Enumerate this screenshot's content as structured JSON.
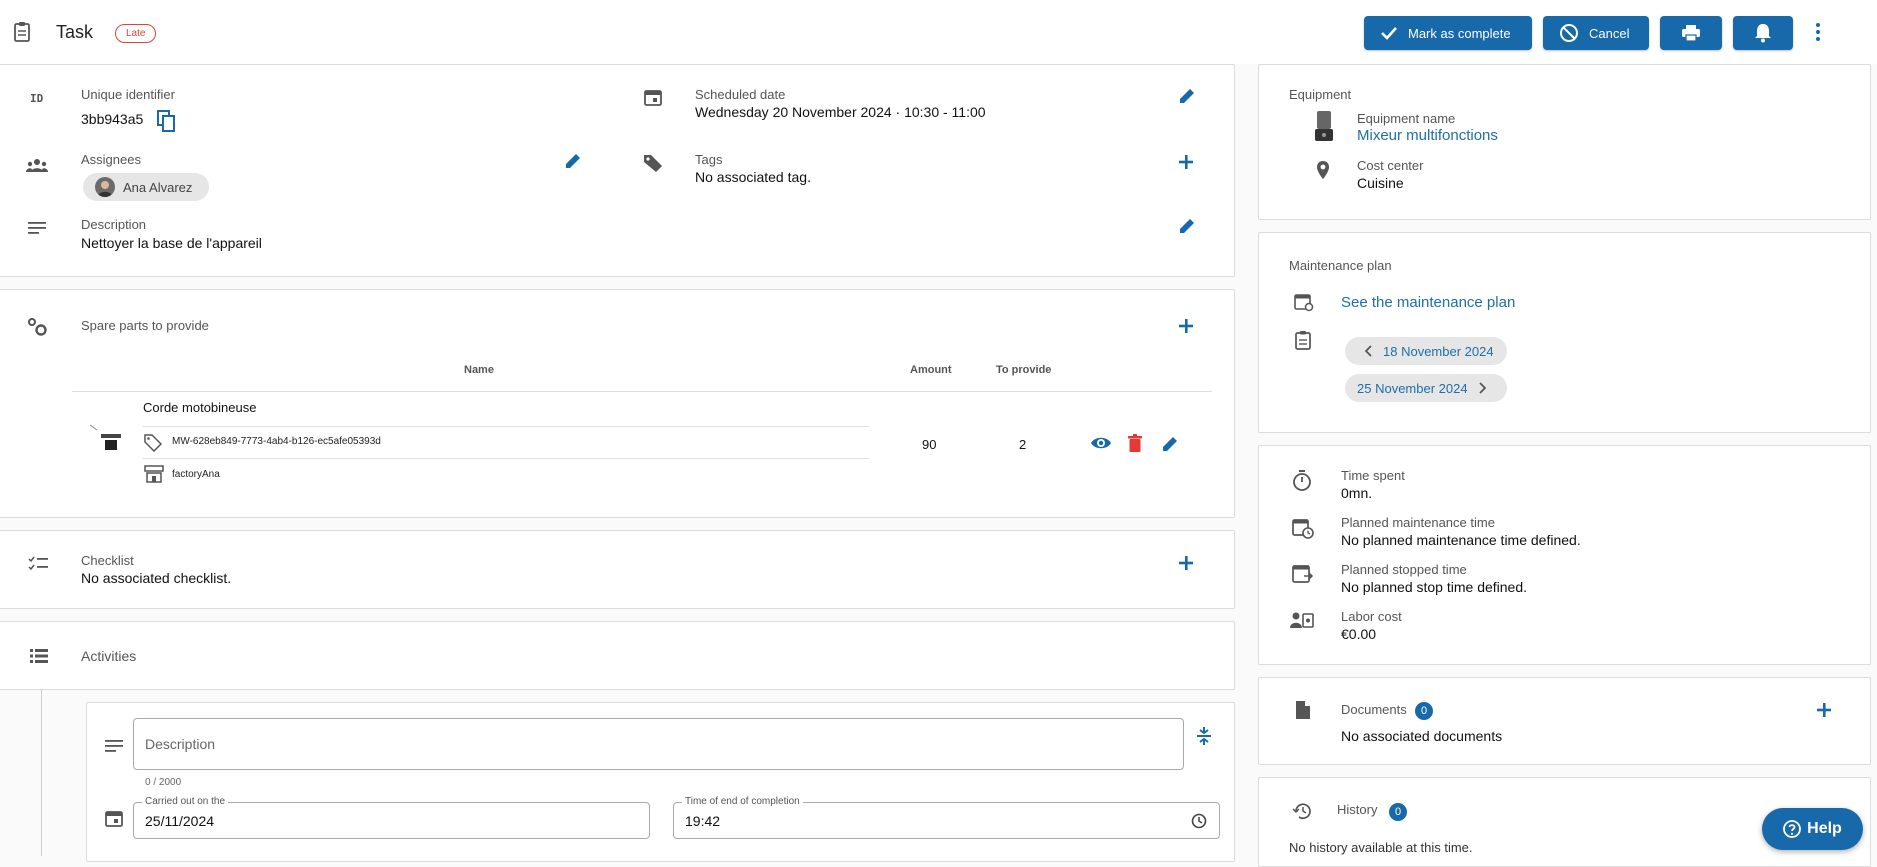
{
  "header": {
    "title": "Task",
    "status_badge": "Late",
    "mark_complete_label": "Mark as complete",
    "cancel_label": "Cancel"
  },
  "details": {
    "id_icon_text": "ID",
    "unique_id_label": "Unique identifier",
    "unique_id_value": "3bb943a5",
    "scheduled_label": "Scheduled date",
    "scheduled_value": "Wednesday 20 November 2024 · 10:30 - 11:00",
    "assignees_label": "Assignees",
    "assignee_name": "Ana Alvarez",
    "tags_label": "Tags",
    "tags_value": "No associated tag.",
    "description_label": "Description",
    "description_value": "Nettoyer la base de l'appareil"
  },
  "spare_parts": {
    "title": "Spare parts to provide",
    "columns": {
      "name": "Name",
      "amount": "Amount",
      "to_provide": "To provide"
    },
    "row": {
      "name": "Corde motobineuse",
      "reference": "MW-628eb849-7773-4ab4-b126-ec5afe05393d",
      "store": "factoryAna",
      "amount": "90",
      "to_provide": "2"
    }
  },
  "checklist": {
    "title": "Checklist",
    "value": "No associated checklist."
  },
  "activities": {
    "title": "Activities",
    "description_placeholder": "Description",
    "char_count": "0 / 2000",
    "carried_out_label": "Carried out on the",
    "carried_out_value": "25/11/2024",
    "end_time_label": "Time of end of completion",
    "end_time_value": "19:42"
  },
  "equipment": {
    "title": "Equipment",
    "name_label": "Equipment name",
    "name_value": "Mixeur multifonctions",
    "cost_center_label": "Cost center",
    "cost_center_value": "Cuisine"
  },
  "maintenance": {
    "title": "Maintenance plan",
    "link": "See the maintenance plan",
    "prev_date": "18 November 2024",
    "next_date": "25 November 2024"
  },
  "time": {
    "spent_label": "Time spent",
    "spent_value": "0mn.",
    "planned_label": "Planned maintenance time",
    "planned_value": "No planned maintenance time defined.",
    "stopped_label": "Planned stopped time",
    "stopped_value": "No planned stop time defined.",
    "labor_label": "Labor cost",
    "labor_value": "€0.00"
  },
  "documents": {
    "title": "Documents",
    "count": "0",
    "value": "No associated documents"
  },
  "history": {
    "title": "History",
    "count": "0",
    "value": "No history available at this time."
  },
  "help_label": "Help",
  "colors": {
    "primary": "#1769aa",
    "late": "#d9453a",
    "delete": "#e53935"
  }
}
